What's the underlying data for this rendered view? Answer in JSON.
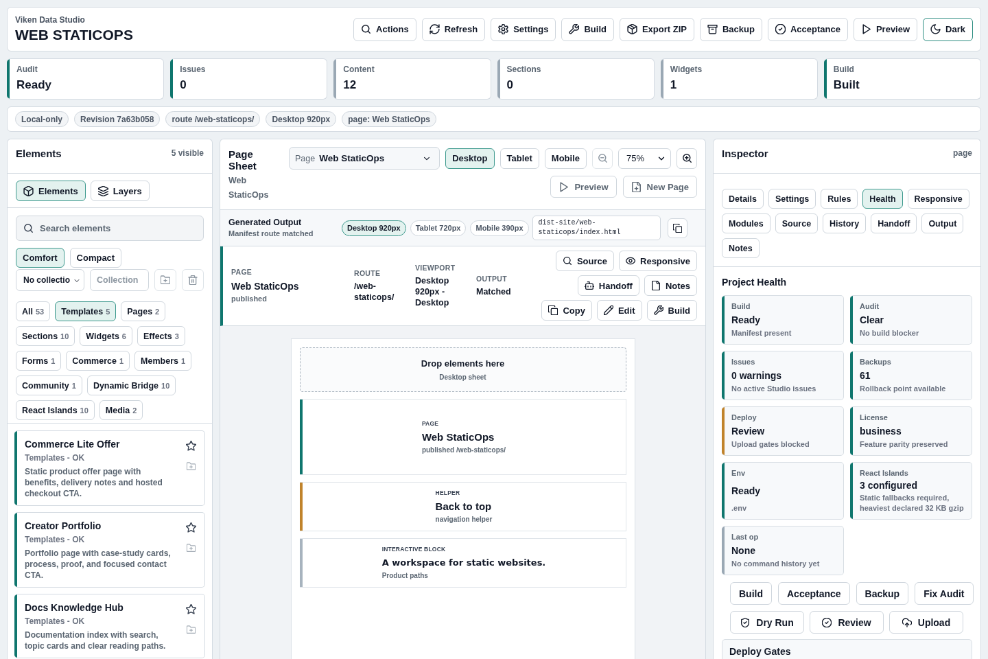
{
  "header": {
    "org": "Viken Data Studio",
    "title": "WEB STATICOPS",
    "buttons": [
      {
        "label": "Actions",
        "active": false
      },
      {
        "label": "Refresh",
        "active": false
      },
      {
        "label": "Settings",
        "active": false
      },
      {
        "label": "Build",
        "active": false
      },
      {
        "label": "Export ZIP",
        "active": false
      },
      {
        "label": "Backup",
        "active": false
      },
      {
        "label": "Acceptance",
        "active": false
      },
      {
        "label": "Preview",
        "active": false
      },
      {
        "label": "Dark",
        "active": true
      }
    ]
  },
  "stats": [
    {
      "label": "Audit",
      "value": "Ready",
      "color": "#0f766e"
    },
    {
      "label": "Issues",
      "value": "0",
      "color": "#0f766e"
    },
    {
      "label": "Content",
      "value": "12",
      "color": "#9aa8b4"
    },
    {
      "label": "Sections",
      "value": "0",
      "color": "#9aa8b4"
    },
    {
      "label": "Widgets",
      "value": "1",
      "color": "#9aa8b4"
    },
    {
      "label": "Build",
      "value": "Built",
      "color": "#0f766e"
    }
  ],
  "context_chips": [
    "Local-only",
    "Revision 7a63b058",
    "route /web-staticops/",
    "Desktop 920px",
    "page: Web StaticOps"
  ],
  "elements_panel": {
    "title": "Elements",
    "count": "5 visible",
    "tabs": [
      {
        "label": "Elements",
        "selected": true
      },
      {
        "label": "Layers",
        "selected": false
      }
    ],
    "search": {
      "placeholder": "Search elements"
    },
    "density": [
      {
        "label": "Comfort",
        "selected": true
      },
      {
        "label": "Compact",
        "selected": false
      }
    ],
    "collection_select": {
      "value": "No collectio"
    },
    "collection_field": {
      "placeholder": "Collection"
    },
    "filters": [
      {
        "label": "All",
        "count": "53",
        "selected": false
      },
      {
        "label": "Templates",
        "count": "5",
        "selected": true
      },
      {
        "label": "Pages",
        "count": "2",
        "selected": false
      },
      {
        "label": "Sections",
        "count": "10",
        "selected": false
      },
      {
        "label": "Widgets",
        "count": "6",
        "selected": false
      },
      {
        "label": "Effects",
        "count": "3",
        "selected": false
      },
      {
        "label": "Forms",
        "count": "1",
        "selected": false
      },
      {
        "label": "Commerce",
        "count": "1",
        "selected": false
      },
      {
        "label": "Members",
        "count": "1",
        "selected": false
      },
      {
        "label": "Community",
        "count": "1",
        "selected": false
      },
      {
        "label": "Dynamic Bridge",
        "count": "10",
        "selected": false
      },
      {
        "label": "React Islands",
        "count": "10",
        "selected": false
      },
      {
        "label": "Media",
        "count": "2",
        "selected": false
      }
    ],
    "items": [
      {
        "title": "Commerce Lite Offer",
        "meta": "Templates - OK",
        "description": "Static product offer page with benefits, delivery notes and hosted checkout CTA.",
        "color": "#0f766e"
      },
      {
        "title": "Creator Portfolio",
        "meta": "Templates - OK",
        "description": "Portfolio page with case-study cards, process, proof, and focused contact CTA.",
        "color": "#0f766e"
      },
      {
        "title": "Docs Knowledge Hub",
        "meta": "Templates - OK",
        "description": "Documentation index with search, topic cards and clear reading paths.",
        "color": "#0f766e"
      }
    ]
  },
  "sheet": {
    "title": "Page Sheet",
    "subtitle": "Web StaticOps",
    "page_select": {
      "label": "Page",
      "value": "Web StaticOps"
    },
    "viewports": [
      {
        "label": "Desktop",
        "selected": true
      },
      {
        "label": "Tablet",
        "selected": false
      },
      {
        "label": "Mobile",
        "selected": false
      }
    ],
    "zoom": {
      "value": "75%",
      "out_disabled": true,
      "in_disabled": false
    },
    "actions": [
      {
        "label": "Preview",
        "disabled": true
      },
      {
        "label": "New Page",
        "disabled": true
      }
    ]
  },
  "output": {
    "title": "Generated Output",
    "status": "Manifest route matched",
    "sizes": [
      {
        "label": "Desktop 920px",
        "selected": true
      },
      {
        "label": "Tablet 720px",
        "selected": false
      },
      {
        "label": "Mobile 390px",
        "selected": false
      }
    ],
    "path": "dist-site/web-staticops/index.html"
  },
  "page_row": {
    "fields": [
      {
        "label": "PAGE",
        "value": "Web StaticOps",
        "note": "published"
      },
      {
        "label": "ROUTE",
        "value": "/web-staticops/"
      },
      {
        "label": "VIEWPORT",
        "value": "Desktop 920px - Desktop"
      },
      {
        "label": "OUTPUT",
        "value": "Matched"
      }
    ],
    "buttons": [
      "Source",
      "Responsive",
      "Handoff",
      "Notes",
      "Copy",
      "Edit",
      "Build"
    ]
  },
  "canvas": {
    "drop_zone": {
      "title": "Drop elements here",
      "note": "Desktop sheet"
    },
    "blocks": [
      {
        "kind": "page",
        "label": "PAGE",
        "title": "Web StaticOps",
        "note": "published /web-staticops/",
        "color": "#0f766e"
      },
      {
        "kind": "helper",
        "label": "HELPER",
        "title": "Back to top",
        "note": "navigation helper",
        "color": "#c0832b"
      },
      {
        "kind": "interactive",
        "label": "INTERACTIVE BLOCK",
        "title": "A workspace for static websites.",
        "note": "Product paths",
        "color": "#a7b3be"
      }
    ]
  },
  "inspector": {
    "title": "Inspector",
    "scope": "page",
    "tabs": [
      {
        "label": "Details",
        "selected": false
      },
      {
        "label": "Settings",
        "selected": false
      },
      {
        "label": "Rules",
        "selected": false
      },
      {
        "label": "Health",
        "selected": true
      },
      {
        "label": "Responsive",
        "selected": false
      },
      {
        "label": "Modules",
        "selected": false
      },
      {
        "label": "Source",
        "selected": false
      },
      {
        "label": "History",
        "selected": false
      },
      {
        "label": "Handoff",
        "selected": false
      },
      {
        "label": "Output",
        "selected": false
      },
      {
        "label": "Notes",
        "selected": false
      }
    ],
    "section_title": "Project Health",
    "cards": [
      {
        "label": "Build",
        "value": "Ready",
        "note": "Manifest present",
        "color": "#0f766e"
      },
      {
        "label": "Audit",
        "value": "Clear",
        "note": "No build blocker",
        "color": "#0f766e"
      },
      {
        "label": "Issues",
        "value": "0 warnings",
        "note": "No active Studio issues",
        "color": "#0f766e"
      },
      {
        "label": "Backups",
        "value": "61",
        "note": "Rollback point available",
        "color": "#0f766e"
      },
      {
        "label": "Deploy",
        "value": "Review",
        "note": "Upload gates blocked",
        "color": "#c0832b"
      },
      {
        "label": "License",
        "value": "business",
        "note": "Feature parity preserved",
        "color": "#0f766e"
      },
      {
        "label": "Env",
        "value": "Ready",
        "note": ".env",
        "color": "#0f766e"
      },
      {
        "label": "React Islands",
        "value": "3 configured",
        "note": "Static fallbacks required, heaviest declared 32 KB gzip",
        "color": "#0f766e"
      },
      {
        "label": "Last op",
        "value": "None",
        "note": "No command history yet",
        "color": "#9aa8b4"
      }
    ],
    "actions": [
      "Build",
      "Acceptance",
      "Backup",
      "Fix Audit"
    ],
    "icon_actions": [
      "Dry Run",
      "Review",
      "Upload"
    ],
    "gates": {
      "title": "Deploy Gates"
    }
  }
}
